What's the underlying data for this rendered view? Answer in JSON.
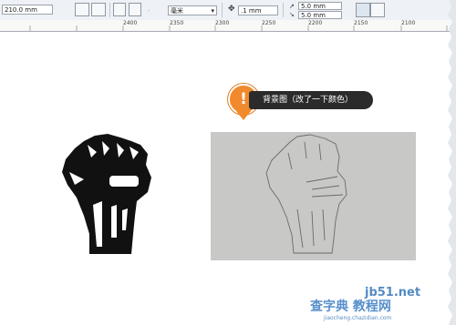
{
  "toolbar": {
    "width_value": "210.0 mm",
    "units_value": "毫米",
    "nudge_value": ".1 mm",
    "dup_x_value": "5.0 mm",
    "dup_y_value": "5.0 mm"
  },
  "ruler": {
    "ticks": [
      "2400",
      "2350",
      "2300",
      "2250",
      "2200",
      "2150",
      "2100"
    ]
  },
  "callout": {
    "mark": "!",
    "text": "背景图（改了一下颜色）"
  },
  "watermark": {
    "site": "jb51.net",
    "name": "查字典 教程网",
    "url": "jiaocheng.chazidian.com"
  },
  "colors": {
    "callout_bg": "#2b2b2b",
    "pin": "#f1892d",
    "panel": "#c8c8c6"
  }
}
